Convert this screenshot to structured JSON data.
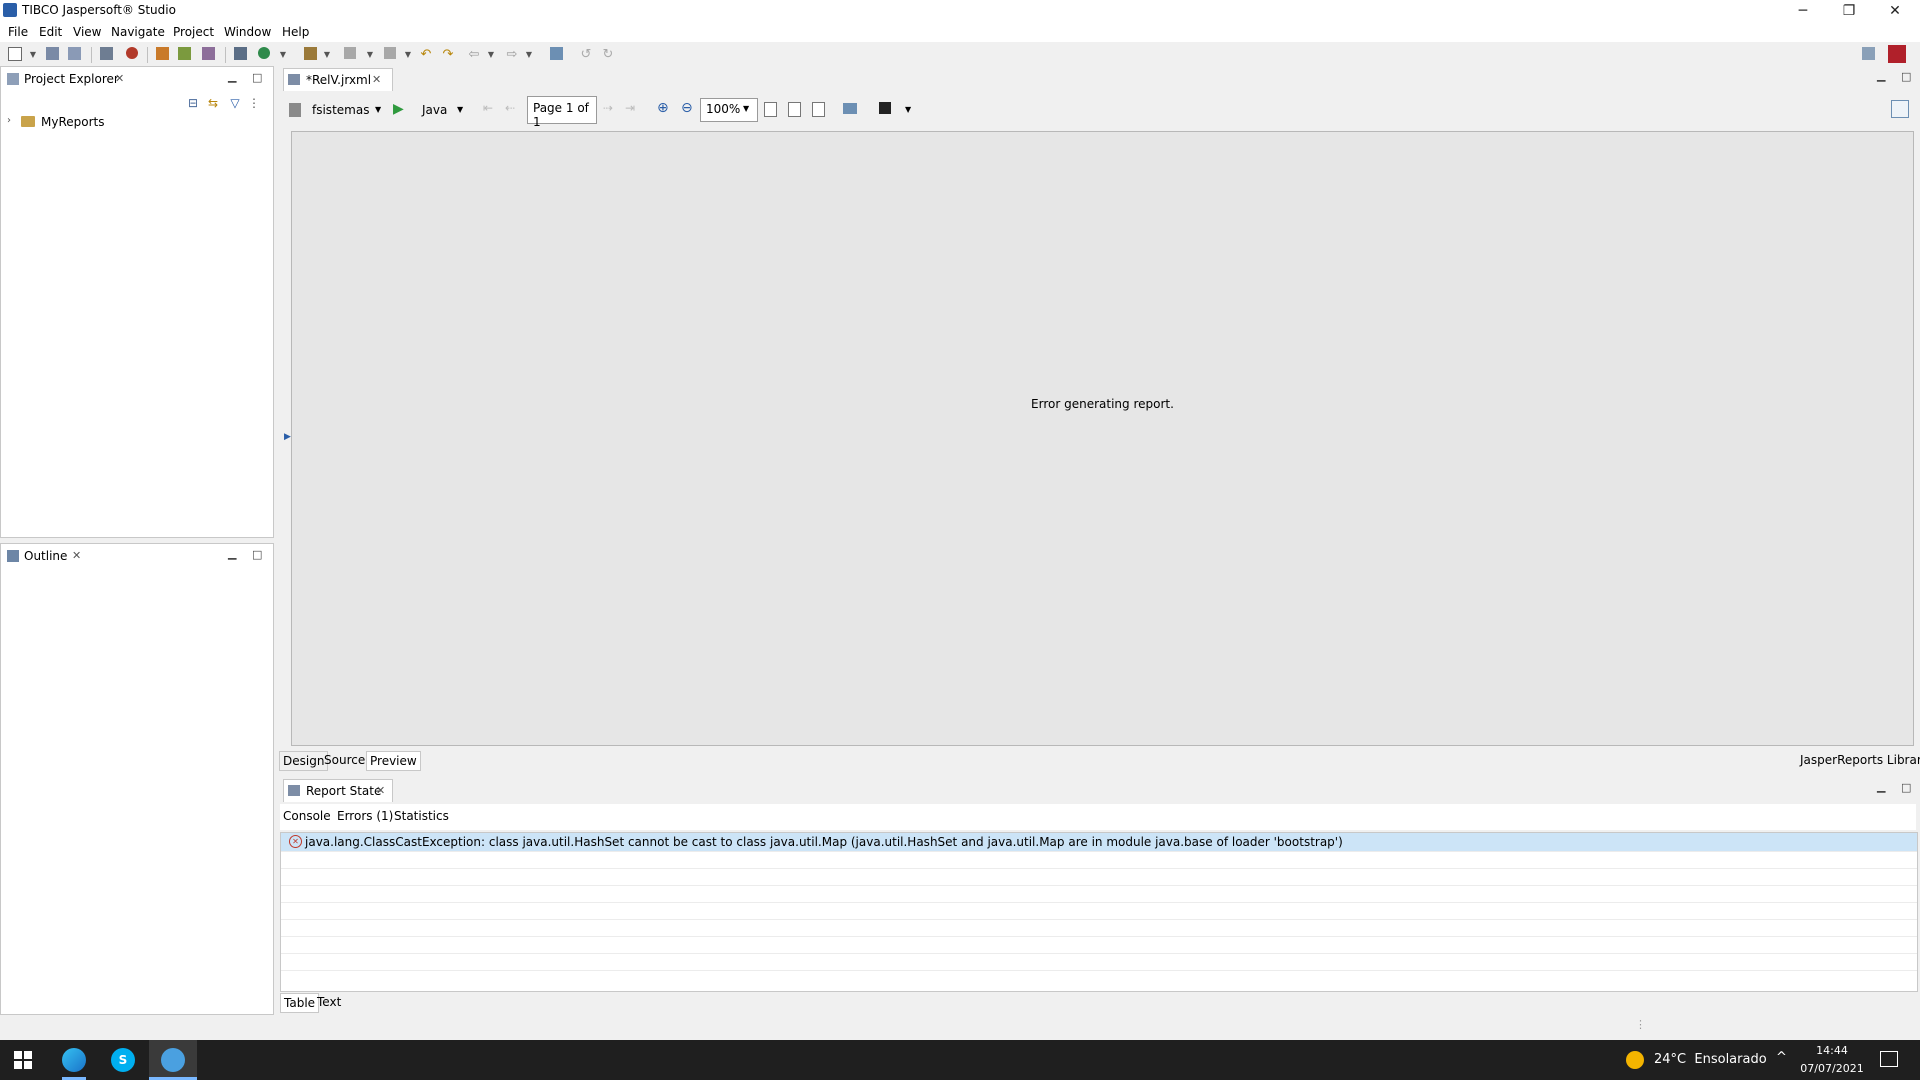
{
  "window": {
    "title": "TIBCO Jaspersoft® Studio",
    "controls": {
      "minimize": "─",
      "restore": "❐",
      "close": "✕"
    }
  },
  "menu": [
    "File",
    "Edit",
    "View",
    "Navigate",
    "Project",
    "Window",
    "Help"
  ],
  "project_explorer": {
    "title": "Project Explorer",
    "tree": [
      {
        "label": "MyReports"
      }
    ]
  },
  "outline": {
    "title": "Outline"
  },
  "editor": {
    "tab_label": "*RelV.jrxml",
    "datasource": "fsistemas",
    "language": "Java",
    "page_indicator": "Page 1 of 1",
    "zoom": "100%",
    "message": "Error generating report.",
    "bottom_tabs": [
      "Design",
      "Source",
      "Preview"
    ],
    "library_label": "JasperReports Library"
  },
  "report_state": {
    "title": "Report State",
    "tabs": [
      "Console",
      "Errors (1)",
      "Statistics"
    ],
    "errors": [
      "java.lang.ClassCastException: class java.util.HashSet cannot be cast to class java.util.Map (java.util.HashSet and java.util.Map are in module java.base of loader 'bootstrap')"
    ],
    "bottom_tabs": [
      "Table",
      "Text"
    ]
  },
  "taskbar": {
    "weather": "24°C  Ensolarado",
    "time": "14:44",
    "date": "07/07/2021"
  }
}
